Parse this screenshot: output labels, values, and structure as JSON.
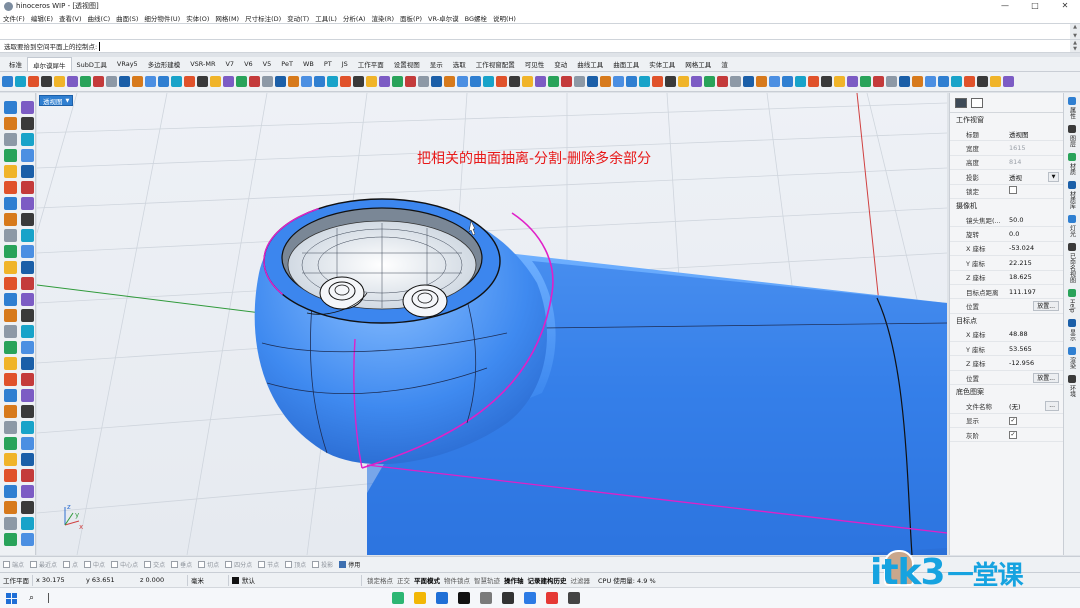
{
  "window": {
    "title": "hinoceros WIP - [透视图]",
    "controls": [
      "—",
      "□",
      "✕"
    ]
  },
  "menu": [
    "文件(F)",
    "编辑(E)",
    "查看(V)",
    "曲线(C)",
    "曲面(S)",
    "细分物件(U)",
    "实体(O)",
    "网格(M)",
    "尺寸标注(D)",
    "变动(T)",
    "工具(L)",
    "分析(A)",
    "渲染(R)",
    "面板(P)",
    "VR-卓尔谟",
    "BG螺栓",
    "说明(H)"
  ],
  "command": {
    "prompt": "选取要拾到空间平面上的控制点:"
  },
  "tabs": [
    {
      "label": "标准",
      "active": false
    },
    {
      "label": "卓尔谟犀牛",
      "active": true
    },
    {
      "label": "SubD工具",
      "active": false
    },
    {
      "label": "VRay5",
      "active": false
    },
    {
      "label": "多边形建模",
      "active": false
    },
    {
      "label": "VSR-MR",
      "active": false
    },
    {
      "label": "V7",
      "active": false
    },
    {
      "label": "V6",
      "active": false
    },
    {
      "label": "V5",
      "active": false
    },
    {
      "label": "PeT",
      "active": false
    },
    {
      "label": "WB",
      "active": false
    },
    {
      "label": "PT",
      "active": false
    },
    {
      "label": "JS",
      "active": false
    },
    {
      "label": "工作平面",
      "active": false
    },
    {
      "label": "设置视图",
      "active": false
    },
    {
      "label": "显示",
      "active": false
    },
    {
      "label": "选取",
      "active": false
    },
    {
      "label": "工作视窗配置",
      "active": false
    },
    {
      "label": "可见性",
      "active": false
    },
    {
      "label": "变动",
      "active": false
    },
    {
      "label": "曲线工具",
      "active": false
    },
    {
      "label": "曲面工具",
      "active": false
    },
    {
      "label": "实体工具",
      "active": false
    },
    {
      "label": "网格工具",
      "active": false
    },
    {
      "label": "渲",
      "active": false
    }
  ],
  "viewport": {
    "label": "透视图",
    "caption": "把相关的曲面抽离-分割-删除多余部分",
    "axes": {
      "x": "x",
      "y": "y",
      "z": "z"
    }
  },
  "panel": {
    "section_viewport": "工作视窗",
    "viewport_props": [
      {
        "key": "标题",
        "value": "透视图",
        "muted": false
      },
      {
        "key": "宽度",
        "value": "1615",
        "muted": true
      },
      {
        "key": "高度",
        "value": "814",
        "muted": true
      }
    ],
    "projection": {
      "key": "投影",
      "value": "透视"
    },
    "lock": {
      "key": "锁定",
      "checked": false
    },
    "section_camera": "摄像机",
    "camera_props": [
      {
        "key": "镜头焦距(...",
        "value": "50.0"
      },
      {
        "key": "旋转",
        "value": "0.0"
      },
      {
        "key": "X 座标",
        "value": "-53.024"
      },
      {
        "key": "Y 座标",
        "value": "22.215"
      },
      {
        "key": "Z 座标",
        "value": "18.625"
      },
      {
        "key": "目标点距离",
        "value": "111.197"
      }
    ],
    "camera_position": {
      "key": "位置",
      "button": "放置..."
    },
    "section_target": "目标点",
    "target_props": [
      {
        "key": "X 座标",
        "value": "48.88"
      },
      {
        "key": "Y 座标",
        "value": "53.565"
      },
      {
        "key": "Z 座标",
        "value": "-12.956"
      }
    ],
    "target_position": {
      "key": "位置",
      "button": "放置..."
    },
    "section_wallpaper": "底色图案",
    "wallpaper_file": {
      "key": "文件名称",
      "value": "(无)",
      "button": "..."
    },
    "wallpaper_show": {
      "key": "显示",
      "checked": true
    },
    "wallpaper_gray": {
      "key": "灰阶",
      "checked": true
    }
  },
  "right_strip": [
    "属性",
    "图层",
    "材质",
    "材质库",
    "灯光",
    "已命名视图",
    "Help",
    "显示",
    "渲染",
    "环境"
  ],
  "osnaps": [
    {
      "label": "端点",
      "on": false
    },
    {
      "label": "最近点",
      "on": false
    },
    {
      "label": "点",
      "on": false
    },
    {
      "label": "中点",
      "on": false
    },
    {
      "label": "中心点",
      "on": false
    },
    {
      "label": "交点",
      "on": false
    },
    {
      "label": "垂点",
      "on": false
    },
    {
      "label": "切点",
      "on": false
    },
    {
      "label": "四分点",
      "on": false
    },
    {
      "label": "节点",
      "on": false
    },
    {
      "label": "顶点",
      "on": false
    },
    {
      "label": "投影",
      "on": false
    },
    {
      "label": "停用",
      "on": true
    }
  ],
  "status": {
    "cplane": "工作平面",
    "x": "x 30.175",
    "y": "y 63.651",
    "z": "z 0.000",
    "unit": "毫米",
    "layer": "默认",
    "toggles": [
      {
        "label": "锁定格点",
        "on": false
      },
      {
        "label": "正交",
        "on": false
      },
      {
        "label": "平面模式",
        "on": true
      },
      {
        "label": "物件锁点",
        "on": false
      },
      {
        "label": "智慧轨迹",
        "on": false
      },
      {
        "label": "操作轴",
        "on": true
      },
      {
        "label": "记录建构历史",
        "on": true
      },
      {
        "label": "过滤器",
        "on": false
      }
    ],
    "cpu": "CPU 使用量: 4.9 %"
  },
  "watermark": {
    "text": "itk3",
    "suffix": "一堂课"
  },
  "colors": {
    "model_blue": "#3f8af0",
    "edge_magenta": "#e020c8",
    "caption_red": "#e81818",
    "viewport_tab": "#2f7fd1"
  }
}
